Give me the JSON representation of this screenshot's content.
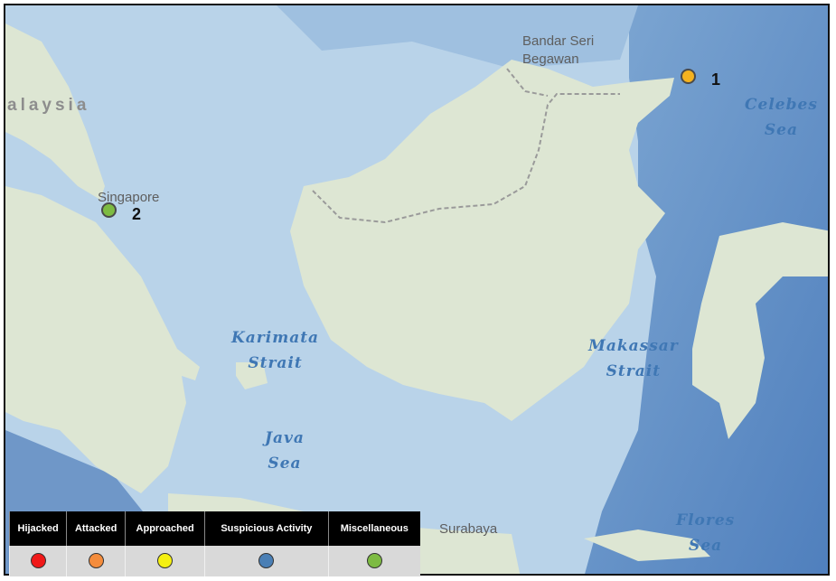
{
  "places": {
    "bandar": "Bandar Seri\nBegawan",
    "malaysia": "alaysia",
    "singapore": "Singapore",
    "surabaya": "Surabaya"
  },
  "seas": {
    "celebes": "Celebes\nSea",
    "karimata": "Karimata\nStrait",
    "makassar": "Makassar\nStrait",
    "java": "Java\nSea",
    "flores": "Flores\nSea"
  },
  "incidents": [
    {
      "number": "1",
      "category": "Approached",
      "color": "#f5b21f"
    },
    {
      "number": "2",
      "category": "Miscellaneous",
      "color": "#7dbb42"
    }
  ],
  "legend": [
    {
      "label": "Hijacked",
      "color": "#f01919"
    },
    {
      "label": "Attacked",
      "color": "#f48c3c"
    },
    {
      "label": "Approached",
      "color": "#f5f011"
    },
    {
      "label": "Suspicious Activity",
      "color": "#4a7fb5"
    },
    {
      "label": "Miscellaneous",
      "color": "#7dbb42"
    }
  ]
}
